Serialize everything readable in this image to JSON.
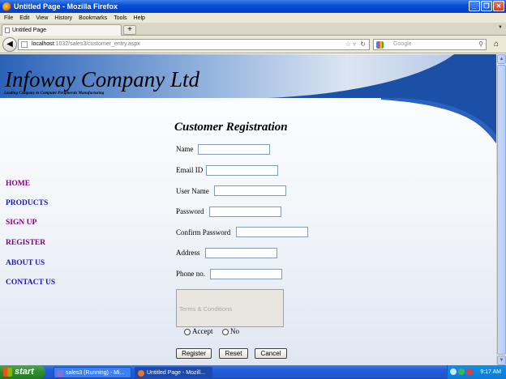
{
  "window": {
    "title": "Untitled Page - Mozilla Firefox"
  },
  "menu": [
    "File",
    "Edit",
    "View",
    "History",
    "Bookmarks",
    "Tools",
    "Help"
  ],
  "tab": {
    "label": "Untitled Page",
    "new_tab": "+"
  },
  "address": {
    "host": "localhost",
    "path": ":1032/sales3/customer_entry.aspx"
  },
  "search": {
    "placeholder": "Google"
  },
  "site": {
    "company": "Infoway Company Ltd",
    "tagline": "Leading Company in Computer Peripherals Manufacturing"
  },
  "nav": {
    "home": "HOME",
    "products": "PRODUCTS",
    "signup": "SIGN UP",
    "register": "REGISTER",
    "about": "ABOUT US",
    "contact": "CONTACT US"
  },
  "form": {
    "title": "Customer Registration",
    "name_label": "Name",
    "email_label": "Email ID",
    "username_label": "User Name",
    "password_label": "Password",
    "confirm_label": "Confirm Password",
    "address_label": "Address",
    "phone_label": "Phone no.",
    "terms": "Terms & Conditions",
    "accept": "Accept",
    "no": "No",
    "register_btn": "Register",
    "reset_btn": "Reset",
    "cancel_btn": "Cancel"
  },
  "taskbar": {
    "start": "start",
    "item1": "sales3 (Running) - Mi...",
    "item2": "Untitled Page - Mozill...",
    "clock": "9:17 AM"
  },
  "colors": {
    "nav_purple": "#800080",
    "nav_blue": "#1a1ab0",
    "title_bar": "#0a4fd8"
  }
}
